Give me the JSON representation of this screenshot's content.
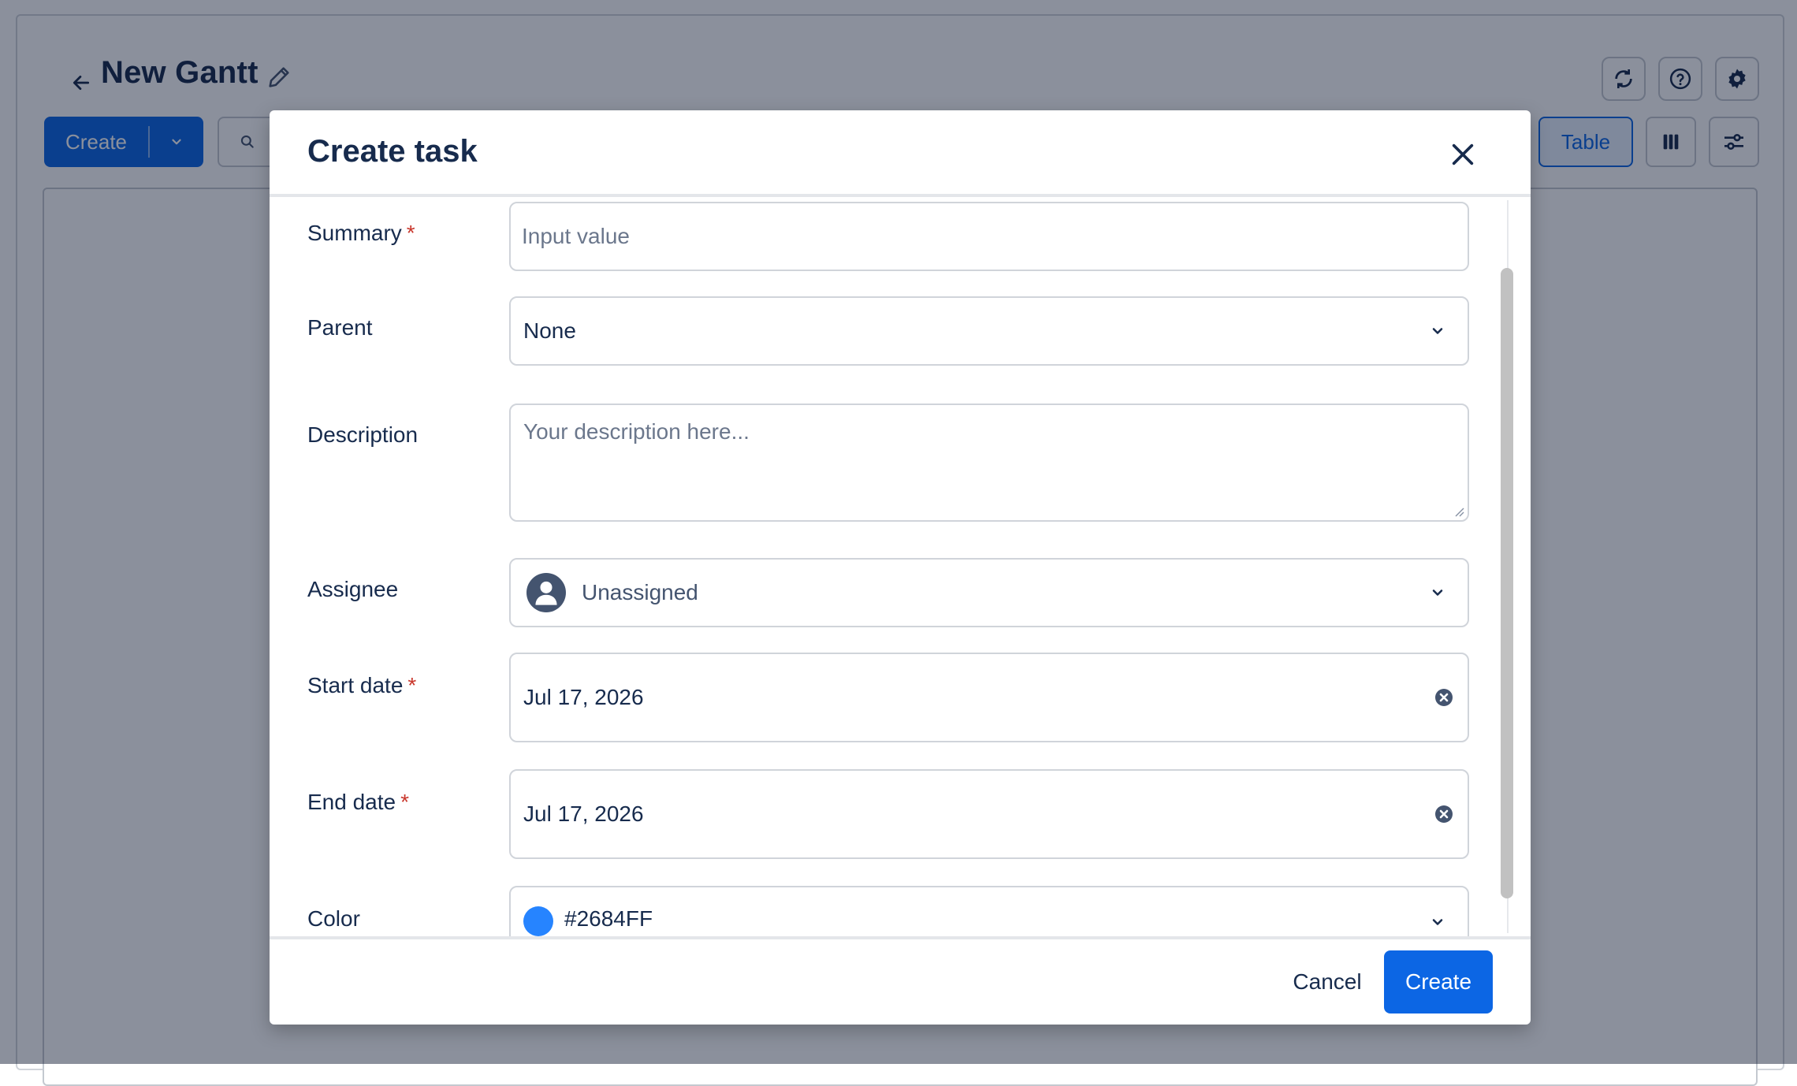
{
  "app": {
    "title": "New Gantt",
    "toolbar": {
      "create_label": "Create",
      "view_table_label": "Table"
    },
    "header_icons": [
      "sync-icon",
      "help-icon",
      "settings-icon"
    ]
  },
  "modal": {
    "title": "Create task",
    "fields": {
      "summary": {
        "label": "Summary",
        "required_mark": "*",
        "placeholder": "Input value",
        "value": ""
      },
      "parent": {
        "label": "Parent",
        "value": "None"
      },
      "description": {
        "label": "Description",
        "placeholder": "Your description here...",
        "value": ""
      },
      "assignee": {
        "label": "Assignee",
        "value": "Unassigned"
      },
      "start_date": {
        "label": "Start date",
        "required_mark": "*",
        "value": "Jul 17, 2026"
      },
      "end_date": {
        "label": "End date",
        "required_mark": "*",
        "value": "Jul 17, 2026"
      },
      "color": {
        "label": "Color",
        "value": "#2684FF",
        "swatch": "#2684FF"
      }
    },
    "footer": {
      "cancel_label": "Cancel",
      "create_label": "Create"
    }
  },
  "colors": {
    "primary": "#0c66e4",
    "required": "#c9372c",
    "text": "#172b4d"
  }
}
